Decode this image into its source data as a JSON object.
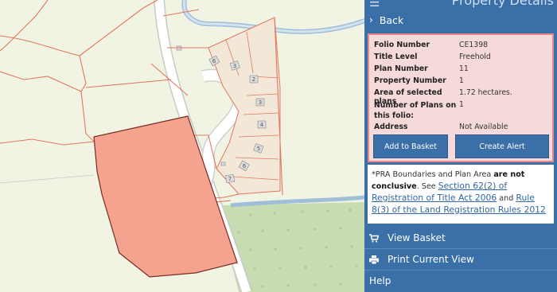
{
  "panel": {
    "title": "Property Details",
    "back_label": "Back",
    "folio": {
      "rows": [
        {
          "key": "Folio Number",
          "value": "CE1398"
        },
        {
          "key": "Title Level",
          "value": "Freehold"
        },
        {
          "key": "Plan Number",
          "value": "11"
        },
        {
          "key": "Property Number",
          "value": "1"
        },
        {
          "key": "Area of selected plans",
          "value": "1.72 hectares."
        },
        {
          "key": "Number of Plans on this folio:",
          "value": "1"
        },
        {
          "key": "Address",
          "value": "Not Available"
        }
      ]
    },
    "buttons": {
      "add_to_basket": "Add to Basket",
      "create_alert": "Create Alert"
    },
    "note": {
      "prefix": "*PRA Boundaries and Plan Area",
      "bold": "are not conclusive",
      "see": ". See",
      "link1": "Section 62(2) of Registration of Title Act 2006",
      "and": "and",
      "link2": "Rule 8(3) of the Land Registration Rules 2012"
    },
    "menu": {
      "view_basket": "View Basket",
      "print_view": "Print Current View",
      "help": "Help"
    }
  },
  "map": {
    "house_numbers": [
      "6",
      "3",
      "2",
      "3",
      "4",
      "5",
      "6",
      "7"
    ],
    "colors": {
      "selected_parcel": "#f4a38e",
      "boundary": "#e2775e",
      "forest": "#c9dcb2",
      "river": "#a8c4dc",
      "panel": "#3a6fa8"
    }
  }
}
